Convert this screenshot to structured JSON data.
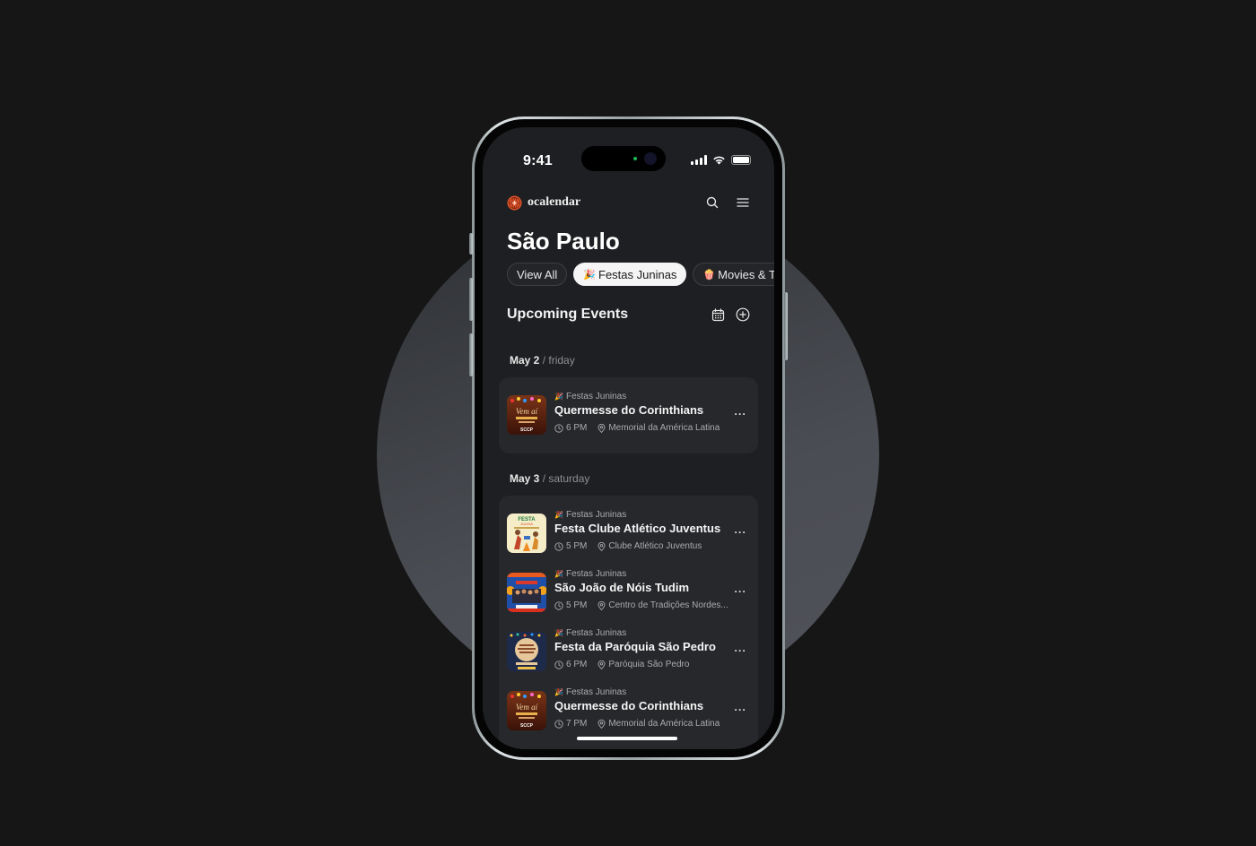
{
  "status_bar": {
    "time": "9:41"
  },
  "app": {
    "brand_name": "ocalendar",
    "brand_color": "#e0552b",
    "icons": [
      "search-icon",
      "menu-icon"
    ]
  },
  "page": {
    "city": "São Paulo",
    "chips": [
      {
        "emoji": "",
        "label": "View All",
        "active": false
      },
      {
        "emoji": "🎉",
        "label": "Festas Juninas",
        "active": true
      },
      {
        "emoji": "🍿",
        "label": "Movies & T",
        "active": false
      }
    ],
    "section_title": "Upcoming Events",
    "section_icons": [
      "calendar-icon",
      "add-circle-icon"
    ]
  },
  "days": [
    {
      "date": "May 2",
      "weekday": "/ friday",
      "events": [
        {
          "category_emoji": "🎉",
          "category": "Festas Juninas",
          "title": "Quermesse do Corinthians",
          "time": "6 PM",
          "location": "Memorial da América Latina",
          "more": "···"
        }
      ]
    },
    {
      "date": "May 3",
      "weekday": "/ saturday",
      "events": [
        {
          "category_emoji": "🎉",
          "category": "Festas Juninas",
          "title": "Festa Clube Atlético Juventus",
          "time": "5 PM",
          "location": "Clube Atlético Juventus",
          "more": "···"
        },
        {
          "category_emoji": "🎉",
          "category": "Festas Juninas",
          "title": "São João de Nóis Tudim",
          "time": "5 PM",
          "location": "Centro de Tradições Nordes...",
          "more": "···"
        },
        {
          "category_emoji": "🎉",
          "category": "Festas Juninas",
          "title": "Festa da Paróquia São Pedro",
          "time": "6 PM",
          "location": "Paróquia São Pedro",
          "more": "···"
        },
        {
          "category_emoji": "🎉",
          "category": "Festas Juninas",
          "title": "Quermesse do Corinthians",
          "time": "7 PM",
          "location": "Memorial da América Latina",
          "more": "···"
        }
      ]
    }
  ]
}
